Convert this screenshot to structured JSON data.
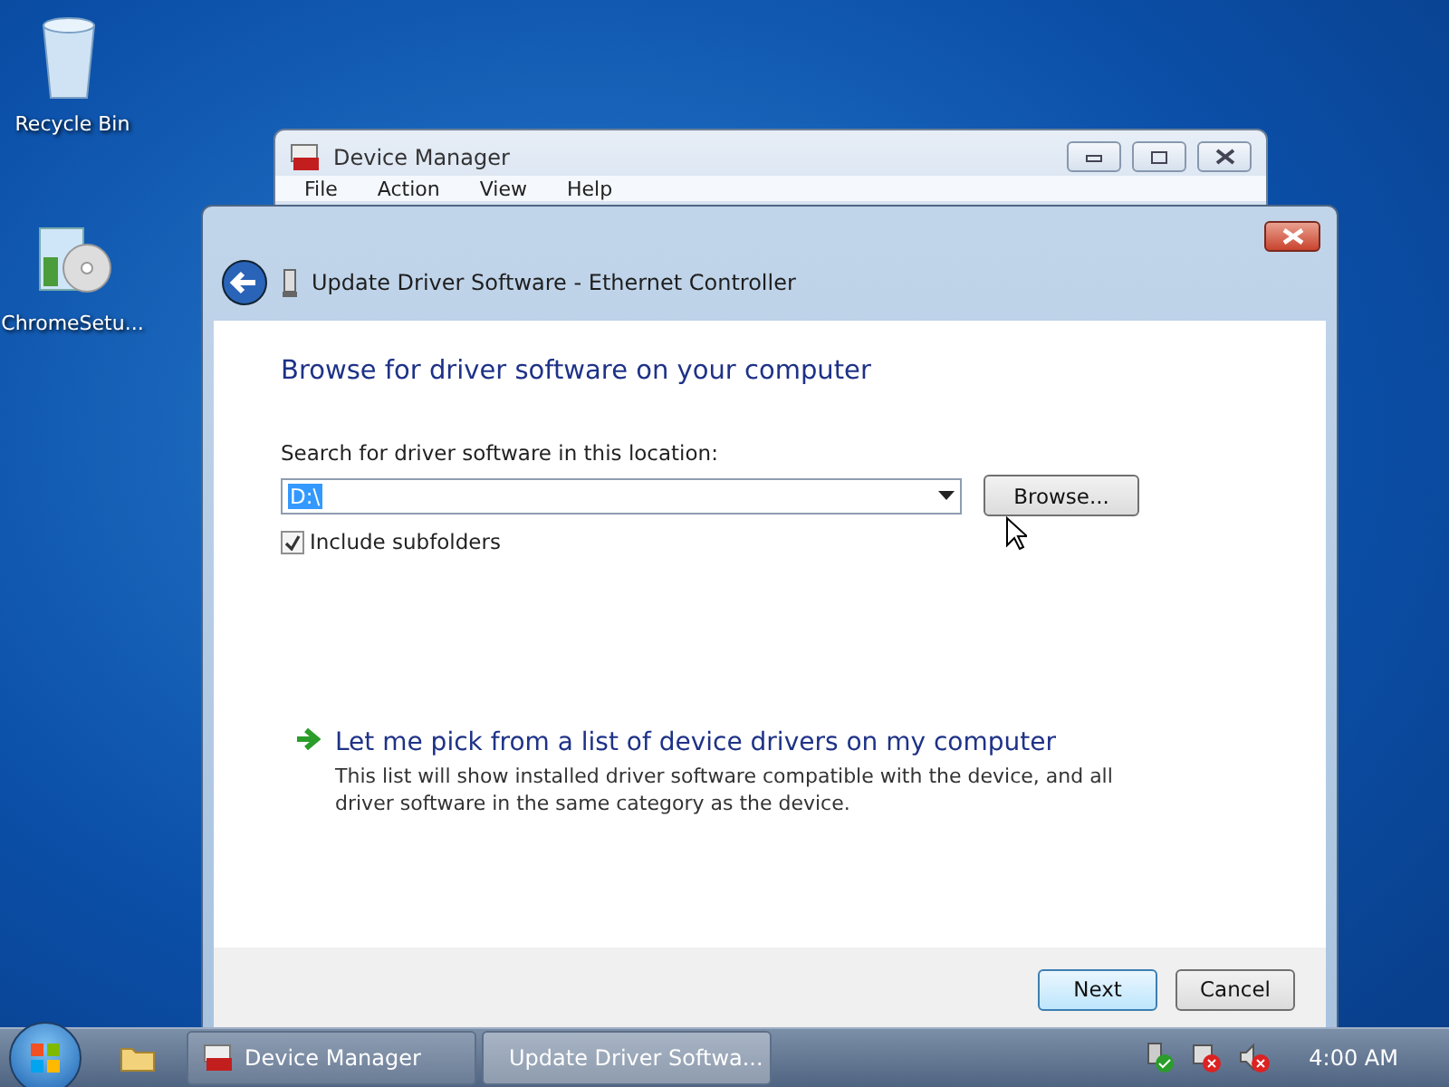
{
  "desktop_icons": [
    {
      "label": "Recycle Bin",
      "kind": "recycle"
    },
    {
      "label": "ChromeSetu...",
      "kind": "installer"
    }
  ],
  "background_window": {
    "title": "Device Manager",
    "menu": [
      "File",
      "Action",
      "View",
      "Help"
    ]
  },
  "dialog": {
    "title": "Update Driver Software - Ethernet Controller",
    "heading": "Browse for driver software on your computer",
    "location_label": "Search for driver software in this location:",
    "location_value": "D:\\",
    "value_selected": true,
    "browse_button": "Browse...",
    "include_subfolders": {
      "label": "Include subfolders",
      "checked": true
    },
    "pick_option": {
      "title": "Let me pick from a list of device drivers on my computer",
      "description": "This list will show installed driver software compatible with the device, and all driver software in the same category as the device."
    },
    "buttons": [
      {
        "label": "Next",
        "default": true
      },
      {
        "label": "Cancel",
        "default": false
      }
    ]
  },
  "taskbar": {
    "items": [
      {
        "label": "Device Manager",
        "kind": "devmgr",
        "selected": false
      },
      {
        "label": "Update Driver Softwa...",
        "kind": "driver",
        "selected": true
      }
    ],
    "clock": "4:00 AM"
  }
}
